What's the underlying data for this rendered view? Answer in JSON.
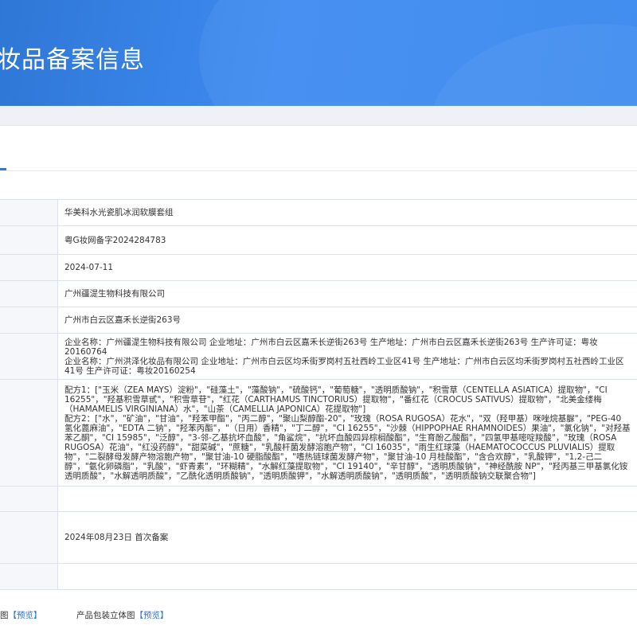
{
  "header": {
    "title": "妆品备案信息"
  },
  "record": {
    "product_name": "华美科水光瓷肌冰润软膜套组",
    "record_number": "粤G妆网备字2024284783",
    "record_date": "2024-07-11",
    "registrant": "广州疆湜生物科技有限公司",
    "registrant_address": "广州市白云区嘉禾长逆街263号",
    "producer_1": "企业名称：广州疆湜生物科技有限公司 企业地址：广州市白云区嘉禾长逆街263号 生产地址：广州市白云区嘉禾长逆街263号 生产许可证：粤妆20160764",
    "producer_2": "企业名称：广州洪泽化妆品有限公司 企业地址：广州市白云区均禾街罗岗村五社西岭工业区41号 生产地址：广州市白云区均禾街罗岗村五社西岭工业区41号 生产许可证：粤妆20160254",
    "formula_1": "配方1：[\"玉米（ZEA MAYS）淀粉\"，\"硅藻土\"，\"藻酸钠\"，\"硫酸钙\"，\"葡萄糖\"，\"透明质酸钠\"，\"积雪草（CENTELLA ASIATICA）提取物\"，\"CI 16255\"，\"羟基积雪草甙\"，\"积雪草苷\"，\"红花（CARTHAMUS TINCTORIUS）提取物\"，\"番红花（CROCUS SATIVUS）提取物\"，\"北美金缕梅（HAMAMELIS VIRGINIANA）水\"，\"山茶（CAMELLIA JAPONICA）花提取物\"]",
    "formula_2": "配方2：[\"水\"，\"矿油\"，\"甘油\"，\"羟苯甲酯\"，\"丙二醇\"，\"聚山梨醇酯-20\"，\"玫瑰（ROSA RUGOSA）花水\"，\"双（羟甲基）咪唑烷基脲\"，\"PEG-40 氢化蓖麻油\"，\"EDTA 二钠\"，\"羟苯丙酯\"，\"（日用）香精\"，\"丁二醇\"，\"CI 16255\"，\"沙棘（HIPPOPHAE RHAMNOIDES）果油\"，\"氯化钠\"，\"对羟基苯乙酮\"，\"CI 15985\"，\"泛醇\"，\"3-邻-乙基抗坏血酸\"，\"角鲨烷\"，\"抗坏血酸四异棕榈酸酯\"，\"生育酚乙酸酯\"，\"四氢甲基嘧啶羧酸\"，\"玫瑰（ROSA RUGOSA）花油\"，\"红没药醇\"，\"甜菜碱\"，\"蔗糖\"，\"乳酸杆菌发酵溶胞产物\"，\"CI 16035\"，\"雨生红球藻（HAEMATOCOCCUS PLUVIALIS）提取物\"，\"二裂酵母发酵产物溶胞产物\"，\"聚甘油-10 硬脂酸酯\"，\"嗜热链球菌发酵产物\"，\"聚甘油-10 月桂酸酯\"，\"含合欢醇\"，\"乳酸钾\"，\"1,2-己二醇\"，\"氨化卵磷脂\"，\"乳酸\"，\"虾青素\"，\"环糊精\"，\"水解红藻提取物\"，\"CI 19140\"，\"辛甘醇\"，\"透明质酸钠\"，\"神经酰胺 NP\"，\"羟丙基三甲基氯化铵透明质酸\"，\"水解透明质酸\"，\"乙酰化透明质酸钠\"，\"透明质酸钾\"，\"水解透明质酸钠\"，\"透明质酸\"，\"透明质酸钠交联聚合物\"]",
    "empty_row": "",
    "record_change": "2024年08月23日 首次备案",
    "empty_row_2": ""
  },
  "footer": {
    "item_1_label": "图",
    "item_1_link": "【预览】",
    "item_2_label": "产品包装立体图",
    "item_2_link": "【预览】"
  },
  "colors": {
    "banner": "#3586ee",
    "link": "#2f6fd6"
  }
}
